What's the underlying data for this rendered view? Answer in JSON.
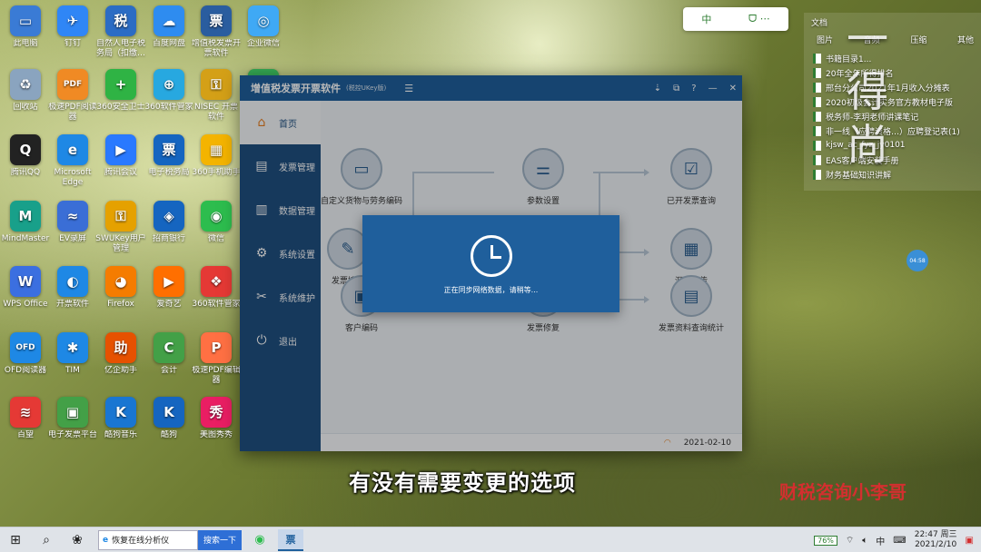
{
  "desktop": {
    "icons": [
      {
        "label": "此电脑",
        "icon": "computer-icon",
        "color": "#3a7bd5",
        "glyph": "▭"
      },
      {
        "label": "钉钉",
        "icon": "dingtalk-icon",
        "color": "#2f86f6",
        "glyph": "✈"
      },
      {
        "label": "自然人电子税务局（扣缴…",
        "icon": "tax-icon",
        "color": "#2b6cc4",
        "glyph": "税"
      },
      {
        "label": "百度网盘",
        "icon": "cloud-icon",
        "color": "#2e8cf0",
        "glyph": "☁"
      },
      {
        "label": "增值税发票开票软件",
        "icon": "invoice-icon",
        "color": "#2a5d9f",
        "glyph": "票"
      },
      {
        "label": "企业微信",
        "icon": "wecom-icon",
        "color": "#3fa9f5",
        "glyph": "◎"
      },
      {
        "label": "回收站",
        "icon": "recycle-bin-icon",
        "color": "#8aa4bf",
        "glyph": "♻"
      },
      {
        "label": "极速PDF阅读器",
        "icon": "pdf-icon",
        "color": "#f08a24",
        "glyph": "PDF"
      },
      {
        "label": "360安全卫士",
        "icon": "shield-plus-icon",
        "color": "#2fb344",
        "glyph": "+"
      },
      {
        "label": "360软件管家",
        "icon": "software-manager-icon",
        "color": "#27a8e0",
        "glyph": "⊕"
      },
      {
        "label": "NISEC 开票软件",
        "icon": "key-icon",
        "color": "#d4a017",
        "glyph": "⚿"
      },
      {
        "label": "360杀毒",
        "icon": "antivirus-icon",
        "color": "#34a853",
        "glyph": "✔"
      },
      {
        "label": "腾讯QQ",
        "icon": "qq-icon",
        "color": "#222222",
        "glyph": "Q"
      },
      {
        "label": "Microsoft Edge",
        "icon": "edge-icon",
        "color": "#1e88e5",
        "glyph": "e"
      },
      {
        "label": "腾讯会议",
        "icon": "meeting-icon",
        "color": "#2979ff",
        "glyph": "▶"
      },
      {
        "label": "电子税务局",
        "icon": "tax-bureau-icon",
        "color": "#1565c0",
        "glyph": "票"
      },
      {
        "label": "360手机助手",
        "icon": "phone-assistant-icon",
        "color": "#f4b400",
        "glyph": "▦"
      },
      {
        "label": "腾讯会议",
        "icon": "meeting2-icon",
        "color": "#1e88e5",
        "glyph": "◆"
      },
      {
        "label": "MindMaster",
        "icon": "mindmap-icon",
        "color": "#18a08a",
        "glyph": "M"
      },
      {
        "label": "EV录屏",
        "icon": "recorder-icon",
        "color": "#3a6ed6",
        "glyph": "≈"
      },
      {
        "label": "SWUKey用户管理",
        "icon": "ukey-icon",
        "color": "#e5a100",
        "glyph": "⚿"
      },
      {
        "label": "招商银行",
        "icon": "bank-icon",
        "color": "#1565c0",
        "glyph": "◈"
      },
      {
        "label": "微信",
        "icon": "wechat-icon",
        "color": "#2dbd4e",
        "glyph": "◉"
      },
      {
        "label": "画图3D",
        "icon": "paint3d-icon",
        "color": "#d94fa0",
        "glyph": "✿"
      },
      {
        "label": "WPS Office",
        "icon": "wps-icon",
        "color": "#3b6fe0",
        "glyph": "W"
      },
      {
        "label": "开票软件",
        "icon": "invoice-app-icon",
        "color": "#1e88e5",
        "glyph": "◐"
      },
      {
        "label": "Firefox",
        "icon": "firefox-icon",
        "color": "#f57c00",
        "glyph": "◕"
      },
      {
        "label": "爱奇艺",
        "icon": "video-icon",
        "color": "#ff6f00",
        "glyph": "▶"
      },
      {
        "label": "360软件管家",
        "icon": "apps-icon",
        "color": "#e53935",
        "glyph": "❖"
      },
      {
        "label": "360安全浏览器",
        "icon": "browser-icon",
        "color": "#43a047",
        "glyph": "e"
      },
      {
        "label": "OFD阅读器",
        "icon": "ofd-icon",
        "color": "#1e88e5",
        "glyph": "OFD"
      },
      {
        "label": "TIM",
        "icon": "tim-icon",
        "color": "#1e88e5",
        "glyph": "✱"
      },
      {
        "label": "亿企助手",
        "icon": "assistant-icon",
        "color": "#e65100",
        "glyph": "助"
      },
      {
        "label": "会计",
        "icon": "accounting-icon",
        "color": "#43a047",
        "glyph": "C"
      },
      {
        "label": "极速PDF编辑器",
        "icon": "pdf-editor-icon",
        "color": "#ff7043",
        "glyph": "P"
      },
      {
        "label": "金税盘",
        "icon": "tax-disk-icon",
        "color": "#1e88e5",
        "glyph": "✎"
      },
      {
        "label": "百望",
        "icon": "baiwang-icon",
        "color": "#e53935",
        "glyph": "≋"
      },
      {
        "label": "电子发票平台",
        "icon": "e-invoice-icon",
        "color": "#43a047",
        "glyph": "▣"
      },
      {
        "label": "酷狗音乐",
        "icon": "music-icon",
        "color": "#1976d2",
        "glyph": "K"
      },
      {
        "label": "酷狗",
        "icon": "kugou-icon",
        "color": "#1565c0",
        "glyph": "K"
      },
      {
        "label": "美图秀秀",
        "icon": "meitu-icon",
        "color": "#e91e63",
        "glyph": "秀"
      }
    ]
  },
  "ime": {
    "label": "中",
    "extra": "ᗜ ⋯"
  },
  "right_panel": {
    "tabs_top": [
      "文档"
    ],
    "tabs": [
      "文档",
      "图片",
      "音频",
      "压缩",
      "其他"
    ],
    "files": [
      "书籍目录1...",
      "20年全年所得排名",
      "邢台分公司2021年1月收入分摊表",
      "2020初级会计实务官方教材电子版",
      "税务师-李玥老师讲课笔记",
      "非一线（应聘资格…）应聘登记表(1)",
      "kjsw_ac_fyz_jy0101",
      "EAS客户端安装手册",
      "财务基础知识讲解"
    ],
    "calligraphy": [
      "一",
      "得",
      "尚"
    ],
    "clock_badge": "04:58"
  },
  "app": {
    "title": "增值税发票开票软件",
    "subtitle": "(税控UKey版)",
    "menu_glyph": "☰",
    "window_controls": [
      "⇣",
      "⧉",
      "?",
      "—",
      "✕"
    ],
    "sidebar": [
      {
        "label": "首页",
        "glyph": "⌂",
        "icon": "home-icon"
      },
      {
        "label": "发票管理",
        "glyph": "▤",
        "icon": "invoice-manage-icon"
      },
      {
        "label": "数据管理",
        "glyph": "▥",
        "icon": "data-manage-icon"
      },
      {
        "label": "系统设置",
        "glyph": "⚙",
        "icon": "settings-icon"
      },
      {
        "label": "系统维护",
        "glyph": "✂",
        "icon": "maintenance-icon"
      },
      {
        "label": "退出",
        "glyph": "⏻",
        "icon": "exit-icon"
      }
    ],
    "nodes": [
      {
        "label": "自定义货物与劳务编码",
        "glyph": "▭",
        "icon": "goods-code-icon"
      },
      {
        "label": "参数设置",
        "glyph": "⚌",
        "icon": "param-settings-icon"
      },
      {
        "label": "已开发票查询",
        "glyph": "☑",
        "icon": "invoice-query-icon"
      },
      {
        "label": "发票填开",
        "glyph": "✎",
        "icon": "invoice-fill-icon"
      },
      {
        "label": "汇总上传",
        "glyph": "▦",
        "icon": "upload-summary-icon"
      },
      {
        "label": "客户编码",
        "glyph": "▣",
        "icon": "customer-code-icon"
      },
      {
        "label": "发票修复",
        "glyph": "✕",
        "icon": "invoice-repair-icon"
      },
      {
        "label": "发票资料查询统计",
        "glyph": "▤",
        "icon": "invoice-stats-icon"
      }
    ],
    "status": {
      "date": "2021-02-10",
      "wifi_glyph": "◠"
    },
    "modal": {
      "text": "正在同步网络数据，请稍等..."
    }
  },
  "overlay": {
    "subtitle": "有没有需要变更的选项",
    "watermark": "财税咨询小李哥"
  },
  "taskbar": {
    "search_placeholder": "恢复在线分析仪",
    "search_button": "搜索一下",
    "battery": "76%",
    "ime": "中",
    "time": "22:47 周三",
    "date": "2021/2/10"
  },
  "colors": {
    "app_primary": "#1f5f9c",
    "sidebar": "#1f4f80",
    "watermark": "#d32f2f"
  }
}
